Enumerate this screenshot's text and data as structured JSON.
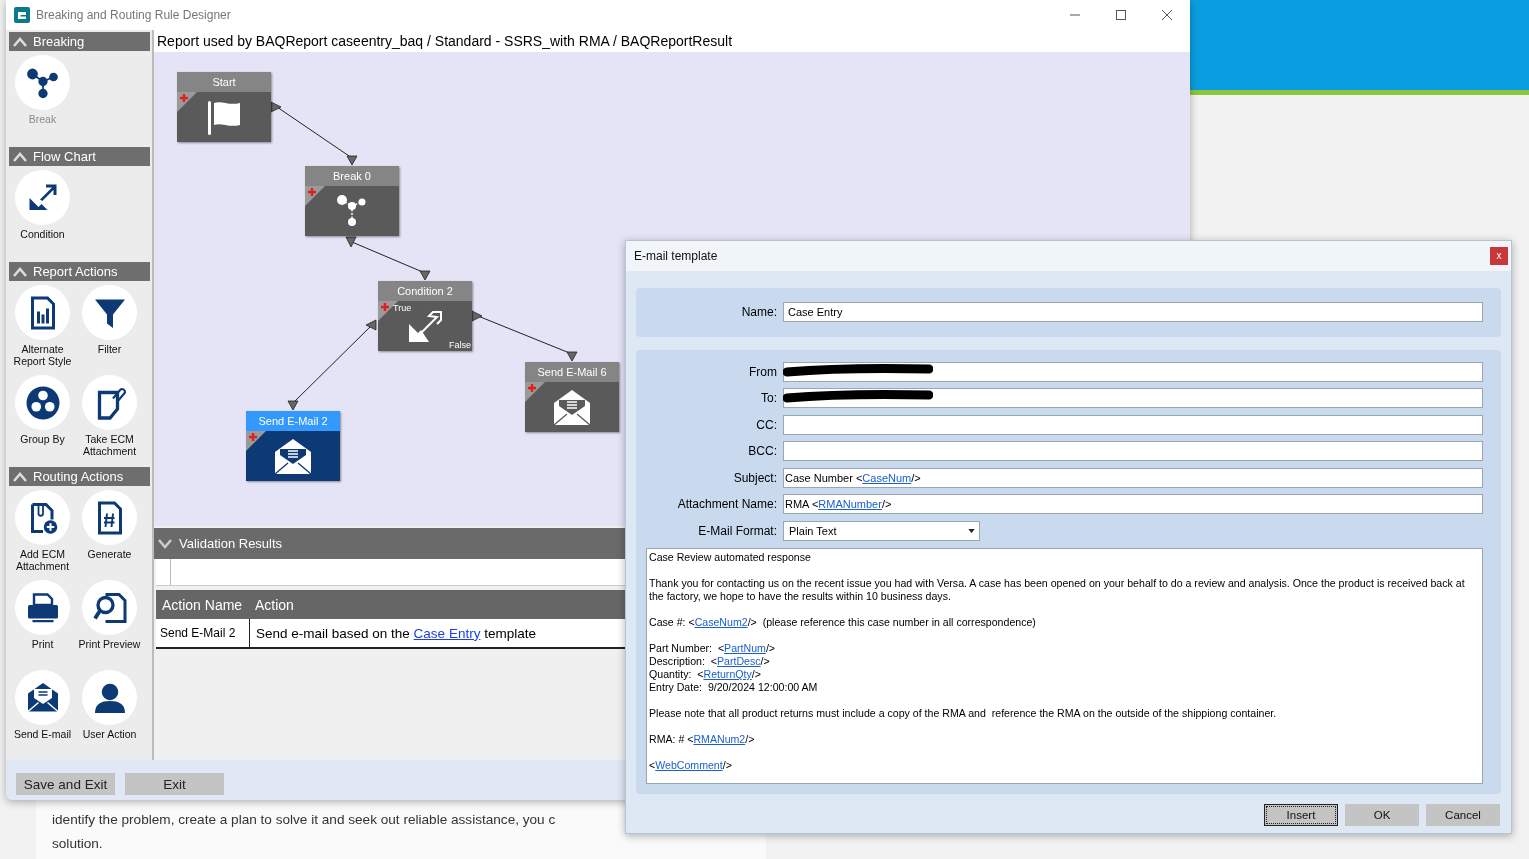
{
  "window": {
    "title": "Breaking and Routing Rule Designer"
  },
  "report_header": "Report used by BAQReport caseentry_baq / Standard - SSRS_with RMA / BAQReportResult",
  "sidebar": {
    "sections": [
      {
        "title": "Breaking",
        "expanded": true,
        "items": [
          {
            "label": "Break",
            "kind": "break",
            "disabled": true
          }
        ]
      },
      {
        "title": "Flow Chart",
        "expanded": true,
        "items": [
          {
            "label": "Condition",
            "kind": "condition",
            "disabled": false
          }
        ]
      },
      {
        "title": "Report Actions",
        "expanded": true,
        "items": [
          {
            "label": "Alternate Report Style",
            "kind": "report-style",
            "disabled": false
          },
          {
            "label": "Filter",
            "kind": "filter",
            "disabled": false
          },
          {
            "label": "Group By",
            "kind": "group-by",
            "disabled": false
          },
          {
            "label": "Take ECM Attachment",
            "kind": "ecm-attachment",
            "disabled": false
          }
        ]
      },
      {
        "title": "Routing Actions",
        "expanded": true,
        "items": [
          {
            "label": "Add ECM Attachment",
            "kind": "add-ecm",
            "disabled": false
          },
          {
            "label": "Generate",
            "kind": "generate",
            "disabled": false
          },
          {
            "label": "Print",
            "kind": "print",
            "disabled": false
          },
          {
            "label": "Print Preview",
            "kind": "print-preview",
            "disabled": false
          },
          {
            "label": "Send E-mail",
            "kind": "send-email",
            "disabled": false
          },
          {
            "label": "User Action",
            "kind": "user-action",
            "disabled": false
          }
        ]
      }
    ]
  },
  "canvas": {
    "nodes": [
      {
        "title": "Start",
        "kind": "start",
        "selected": false
      },
      {
        "title": "Break 0",
        "kind": "break",
        "selected": false
      },
      {
        "title": "Condition 2",
        "kind": "condition",
        "selected": false,
        "true_label": "True",
        "false_label": "False"
      },
      {
        "title": "Send E-Mail 6",
        "kind": "email",
        "selected": false
      },
      {
        "title": "Send E-Mail 2",
        "kind": "email",
        "selected": true
      }
    ]
  },
  "validation": {
    "title": "Validation Results",
    "expanded": true,
    "columns": [
      "Action Name",
      "Action"
    ],
    "rows": [
      {
        "name": "Send E-Mail 2",
        "action": [
          {
            "text": "Send e-mail based on the ",
            "kind": "text"
          },
          {
            "text": "Case Entry",
            "kind": "link"
          },
          {
            "text": " template",
            "kind": "text"
          }
        ]
      }
    ]
  },
  "buttons": [
    "Save and Exit",
    "Exit"
  ],
  "background_text": [
    "identify the problem, create a plan to solve it and seek out reliable assistance, you c",
    "solution."
  ],
  "dialog": {
    "title": "E-mail template",
    "close": "x",
    "name": {
      "label": "Name:",
      "value": "Case Entry"
    },
    "fields": [
      {
        "label": "From",
        "kind": "text",
        "redacted": true
      },
      {
        "label": "To:",
        "kind": "text",
        "redacted": true
      },
      {
        "label": "CC:",
        "kind": "text",
        "redacted": false
      },
      {
        "label": "BCC:",
        "kind": "text",
        "redacted": false
      },
      {
        "label": "Subject:",
        "kind": "text",
        "redacted": false,
        "value": [
          {
            "text": "Case Number <",
            "kind": "text"
          },
          {
            "text": "CaseNum",
            "kind": "tag"
          },
          {
            "text": "/>",
            "kind": "text"
          }
        ]
      },
      {
        "label": "Attachment Name:",
        "kind": "text",
        "redacted": false,
        "value": [
          {
            "text": "RMA <",
            "kind": "text"
          },
          {
            "text": "RMANumber",
            "kind": "tag"
          },
          {
            "text": "/>",
            "kind": "text"
          }
        ]
      },
      {
        "label": "E-Mail Format:",
        "kind": "dropdown",
        "redacted": false,
        "value": [
          {
            "text": "Plain Text",
            "kind": "text"
          }
        ]
      }
    ],
    "body": [
      [
        [
          {
            "text": "Case Review automated response",
            "kind": "text"
          }
        ]
      ],
      [
        [
          {
            "text": "Thank you for contacting us on the recent issue you had with Versa. A case has been opened on your behalf to do a review and analysis. Once the product is received back at the factory, we hope to have the results within 10 business days.",
            "kind": "text"
          }
        ]
      ],
      [
        [
          {
            "text": "Case #: <",
            "kind": "text"
          },
          {
            "text": "CaseNum2",
            "kind": "tag"
          },
          {
            "text": "/>  (please reference this case number in all correspondence)",
            "kind": "text"
          }
        ]
      ],
      [
        [
          {
            "text": "Part Number:  <",
            "kind": "text"
          },
          {
            "text": "PartNum",
            "kind": "tag"
          },
          {
            "text": "/>",
            "kind": "text"
          }
        ],
        [
          {
            "text": "Description:  <",
            "kind": "text"
          },
          {
            "text": "PartDesc",
            "kind": "tag"
          },
          {
            "text": "/>",
            "kind": "text"
          }
        ],
        [
          {
            "text": "Quantity:  <",
            "kind": "text"
          },
          {
            "text": "ReturnQty",
            "kind": "tag"
          },
          {
            "text": "/>",
            "kind": "text"
          }
        ],
        [
          {
            "text": "Entry Date:  9/20/2024 12:00:00 AM",
            "kind": "text"
          }
        ]
      ],
      [
        [
          {
            "text": "Please note that all product returns must include a copy of the RMA and  reference the RMA on the outside of the shippiong container.",
            "kind": "text"
          }
        ]
      ],
      [
        [
          {
            "text": "RMA: # <",
            "kind": "text"
          },
          {
            "text": "RMANum2",
            "kind": "tag"
          },
          {
            "text": "/>",
            "kind": "text"
          }
        ]
      ],
      [
        [
          {
            "text": "<",
            "kind": "text"
          },
          {
            "text": "WebComment",
            "kind": "tag"
          },
          {
            "text": "/>",
            "kind": "text"
          }
        ]
      ]
    ],
    "buttons": [
      {
        "label": "Insert",
        "focused": true
      },
      {
        "label": "OK",
        "focused": false
      },
      {
        "label": "Cancel",
        "focused": false
      }
    ]
  }
}
